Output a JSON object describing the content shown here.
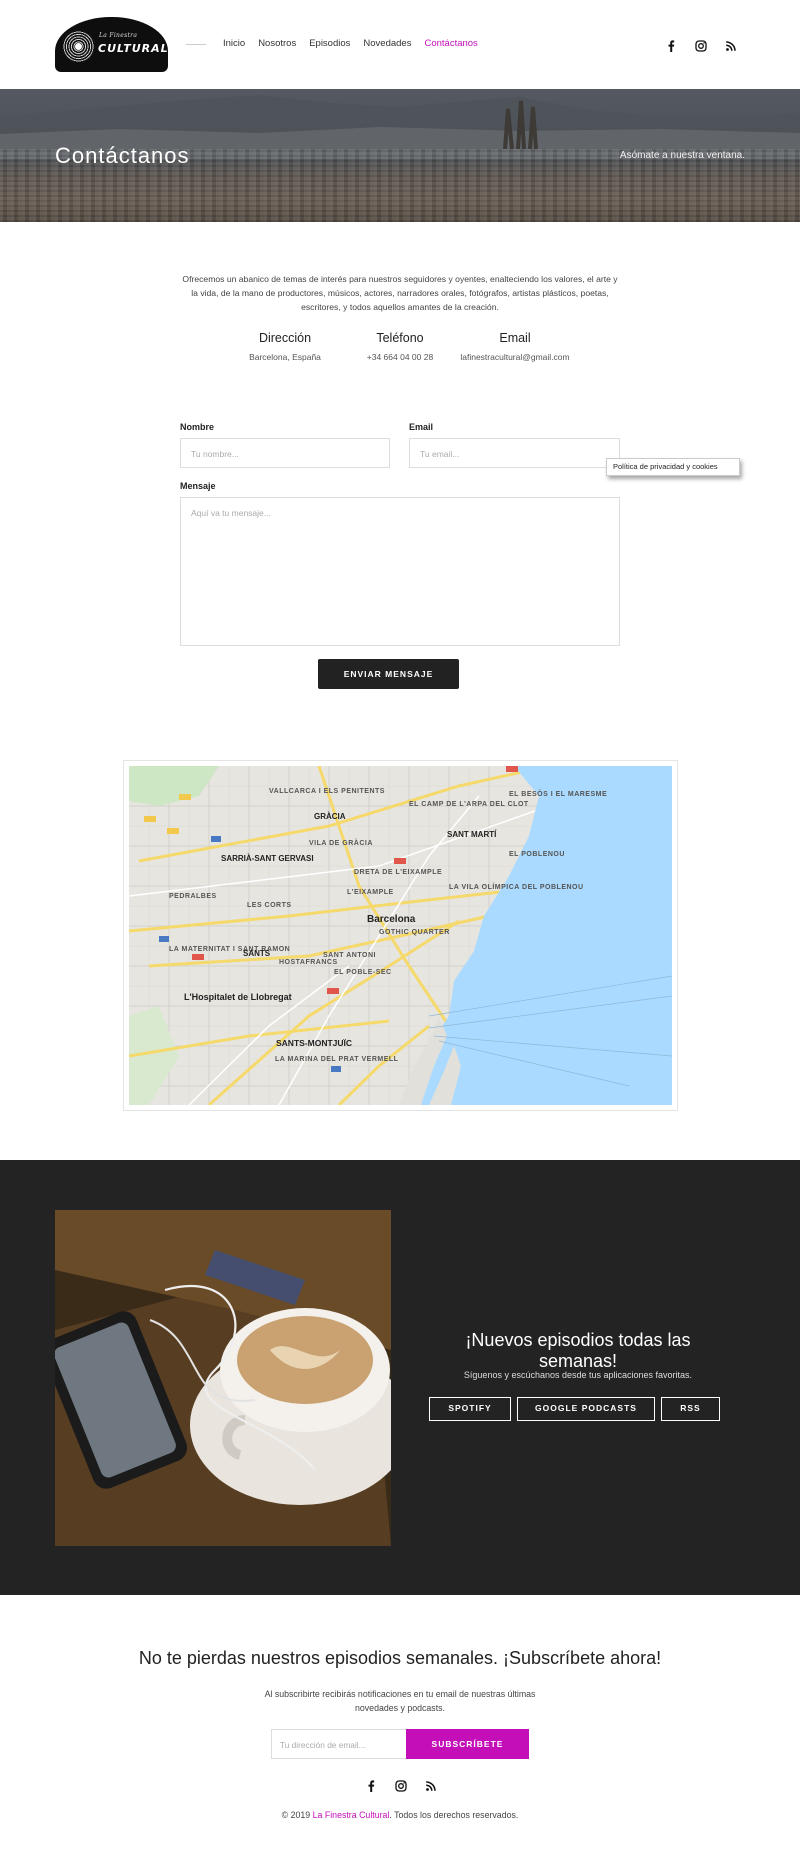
{
  "header": {
    "logo_small": "La Finestra",
    "logo_big": "CULTURAL",
    "nav": [
      {
        "label": "Inicio",
        "active": false
      },
      {
        "label": "Nosotros",
        "active": false
      },
      {
        "label": "Episodios",
        "active": false
      },
      {
        "label": "Novedades",
        "active": false
      },
      {
        "label": "Contáctanos",
        "active": true
      }
    ],
    "social_icons": [
      "facebook-icon",
      "instagram-icon",
      "rss-icon"
    ]
  },
  "hero": {
    "title": "Contáctanos",
    "subtitle": "Asómate a nuestra ventana."
  },
  "intro": {
    "text": "Ofrecemos un abanico de temas de interés para nuestros seguidores y oyentes, enalteciendo los valores, el arte y la vida, de la mano de productores, músicos, actores, narradores orales, fotógrafos, artistas plásticos, poetas, escritores, y todos aquellos amantes de la creación.",
    "info": [
      {
        "heading": "Dirección",
        "value": "Barcelona, España"
      },
      {
        "heading": "Teléfono",
        "value": "+34 664 04 00 28"
      },
      {
        "heading": "Email",
        "value": "lafinestracultural@gmail.com"
      }
    ]
  },
  "form": {
    "name_label": "Nombre",
    "name_placeholder": "Tu nombre...",
    "email_label": "Email",
    "email_placeholder": "Tu email...",
    "message_label": "Mensaje",
    "message_placeholder": "Aquí va tu mensaje...",
    "submit": "ENVIAR MENSAJE",
    "privacy_tooltip": "Política de privacidad y cookies"
  },
  "map": {
    "labels": [
      "VALLCARCA I ELS PENITENTS",
      "GRÀCIA",
      "EL CAMP DE L'ARPA DEL CLOT",
      "EL BESÒS I EL MARESME",
      "SANT MARTÍ",
      "SARRIÀ-SANT GERVASI",
      "VILA DE GRÀCIA",
      "EL POBLENOU",
      "DRETA DE L'EIXAMPLE",
      "LA VILA OLÍMPICA DEL POBLENOU",
      "L'EIXAMPLE",
      "PEDRALBES",
      "LES CORTS",
      "Barcelona",
      "GOTHIC QUARTER",
      "LA MATERNITAT I SANT RAMON",
      "SANTS",
      "HOSTAFRANCS",
      "SANT ANTONI",
      "EL POBLE-SEC",
      "L'Hospitalet de Llobregat",
      "SANTS-MONTJUÏC",
      "LA MARINA DEL PRAT VERMELL"
    ]
  },
  "promo": {
    "title": "¡Nuevos episodios todas las semanas!",
    "subtitle": "Síguenos y escúchanos desde tus aplicaciones favoritas.",
    "buttons": [
      "SPOTIFY",
      "GOOGLE PODCASTS",
      "RSS"
    ]
  },
  "subscribe": {
    "title": "No te pierdas nuestros episodios semanales. ¡Subscríbete ahora!",
    "description": "Al subscribirte recibirás notificaciones en tu email de nuestras últimas novedades y podcasts.",
    "placeholder": "Tu dirección de email...",
    "button": "SUBSCRÍBETE"
  },
  "footer": {
    "copy_prefix": "© 2019",
    "brand": "La Finestra Cultural",
    "copy_suffix": ". Todos los derechos reservados."
  },
  "colors": {
    "accent": "#c40fb9",
    "dark": "#232323",
    "sea": "#aadaff"
  }
}
